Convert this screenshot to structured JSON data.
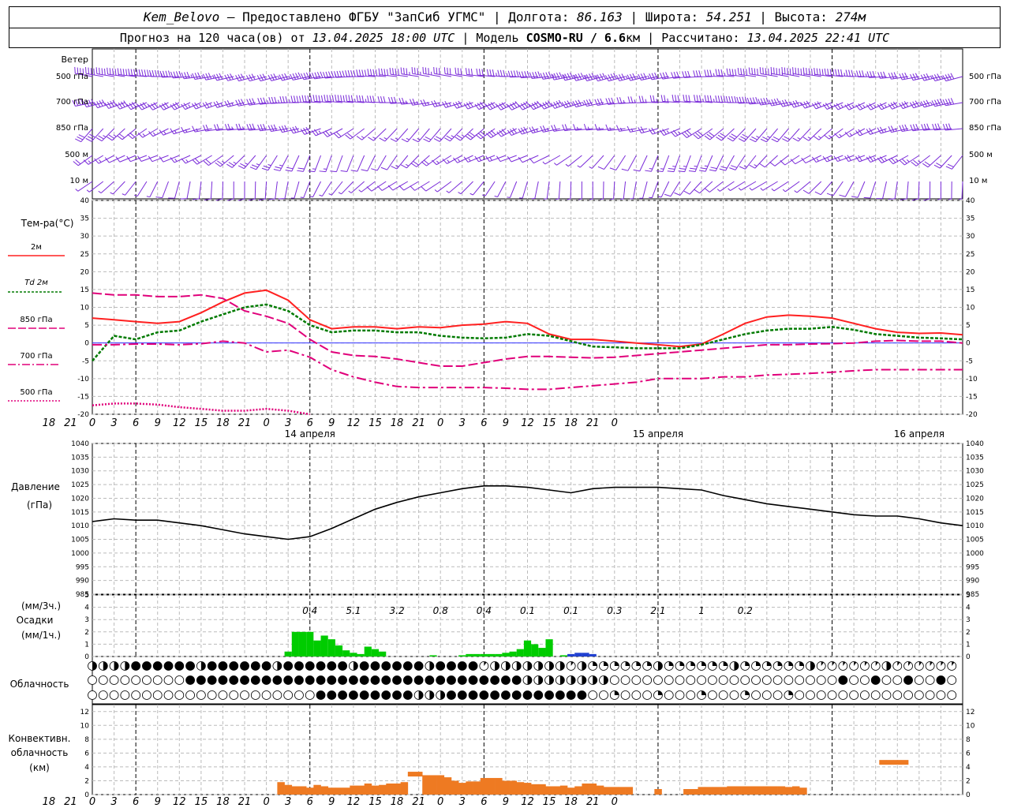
{
  "header": {
    "station": "Kem_Belovo",
    "provided": "— Предоставлено ФГБУ \"ЗапСиб УГМС\"",
    "lon_label": "Долгота:",
    "lon": "86.163",
    "lat_label": "Широта:",
    "lat": "54.251",
    "alt_label": "Высота:",
    "alt": "274м",
    "forecast_prefix": "Прогноз на 120 часа(ов) от",
    "forecast_start": "13.04.2025 18:00 UTC",
    "model_label": "Модель",
    "model": "COSMO-RU / 6.6",
    "model_unit": "км",
    "computed_label": "Рассчитано:",
    "computed": "13.04.2025 22:41 UTC"
  },
  "wind_panel": {
    "title": "Ветер",
    "levels": [
      "500 гПа",
      "700 гПа",
      "850 гПа",
      "500 м",
      "10  м"
    ]
  },
  "temp_panel": {
    "title": "Тем-ра(°C)",
    "legend": [
      {
        "label": "2м",
        "color": "#ff2020",
        "style": "solid"
      },
      {
        "label": "Td  2м",
        "color": "#007a00",
        "style": "dashed"
      },
      {
        "label": "850 гПа",
        "color": "#e0007a",
        "style": "dash"
      },
      {
        "label": "700 гПа",
        "color": "#e0007a",
        "style": "dashdot"
      },
      {
        "label": "500 гПа",
        "color": "#e0007a",
        "style": "dot"
      }
    ]
  },
  "time_axis": {
    "ticks": [
      "18",
      "21",
      "0",
      "3",
      "6",
      "9",
      "12",
      "15",
      "18",
      "21",
      "0",
      "3",
      "6",
      "9",
      "12",
      "15",
      "18",
      "21",
      "0",
      "3",
      "6",
      "9",
      "12",
      "15",
      "18",
      "21",
      "0"
    ],
    "dates": [
      "14 апреля",
      "15 апреля",
      "16 апреля"
    ]
  },
  "pressure_panel": {
    "title": "Давление",
    "unit": "(гПа)"
  },
  "precip_panel": {
    "unit_top": "(мм/3ч.)",
    "title": "Осадки",
    "unit_bottom": "(мм/1ч.)",
    "totals_3h": [
      "0.4",
      "5.1",
      "3.2",
      "0.8",
      "0.4",
      "0.1",
      "0.1",
      "0.3",
      "2.1",
      "1",
      "0.2"
    ]
  },
  "cloud_panel": {
    "title": "Облачность"
  },
  "convective_panel": {
    "title_1": "Конвективн.",
    "title_2": "облачность",
    "unit": "(км)"
  },
  "chart_data": [
    {
      "type": "line",
      "name": "temperature",
      "x_hours": [
        0,
        3,
        6,
        9,
        12,
        15,
        18,
        21,
        24,
        27,
        30,
        33,
        36,
        39,
        42,
        45,
        48,
        51,
        54,
        57,
        60,
        63,
        66,
        69,
        72,
        75,
        78,
        81,
        84,
        87,
        90,
        93,
        96,
        99,
        102,
        105,
        108,
        111,
        114,
        117,
        120
      ],
      "ylim": [
        -20,
        40
      ],
      "yticks": [
        -20,
        -15,
        -10,
        -5,
        0,
        5,
        10,
        15,
        20,
        25,
        30,
        35,
        40
      ],
      "series": [
        {
          "name": "2м",
          "color": "#ff2020",
          "values": [
            7,
            6.5,
            6,
            5.5,
            6,
            8.5,
            11.5,
            14,
            14.8,
            12,
            6.5,
            4,
            4.5,
            4.5,
            4,
            4.5,
            4.3,
            5,
            5.3,
            6,
            5.5,
            2.5,
            1,
            1,
            0.5,
            0,
            -0.5,
            -1,
            -0.3,
            2.5,
            5.5,
            7.3,
            7.8,
            7.5,
            7,
            5.5,
            4,
            3,
            2.7,
            2.8,
            2.3
          ]
        },
        {
          "name": "Td 2м",
          "color": "#007a00",
          "values": [
            -5,
            2,
            1,
            3,
            3.5,
            6,
            8,
            10,
            10.8,
            9,
            5,
            3,
            3.5,
            3.5,
            3,
            3,
            2,
            1.5,
            1.3,
            1.5,
            2.5,
            2,
            0.5,
            -1,
            -1.2,
            -1.5,
            -1.5,
            -1.5,
            -0.5,
            1,
            2.5,
            3.5,
            4,
            4,
            4.5,
            3.7,
            2.5,
            2,
            1.5,
            1.3,
            1
          ]
        },
        {
          "name": "850 гПа",
          "color": "#e0007a",
          "values": [
            14,
            13.5,
            13.5,
            13,
            13,
            13.5,
            12.5,
            9,
            7.5,
            5.5,
            1,
            -2.5,
            -3.5,
            -3.8,
            -4.5,
            -5.5,
            -6.5,
            -6.5,
            -5.5,
            -4.5,
            -3.8,
            -3.8,
            -4,
            -4.2,
            -4,
            -3.5,
            -3,
            -2.5,
            -2,
            -1.5,
            -1,
            -0.5,
            -0.5,
            -0.3,
            -0.2,
            0,
            0.5,
            0.7,
            0.5,
            0.5,
            0
          ]
        },
        {
          "name": "700 гПа",
          "color": "#e0007a",
          "values": [
            -0.5,
            -0.5,
            -0.3,
            -0.3,
            -0.5,
            -0.2,
            0.5,
            0,
            -2.5,
            -2,
            -4,
            -7.5,
            -9.5,
            -11,
            -12.2,
            -12.5,
            -12.5,
            -12.5,
            -12.5,
            -12.7,
            -13,
            -13,
            -12.5,
            -12,
            -11.5,
            -11,
            -10,
            -10,
            -10,
            -9.5,
            -9.5,
            -9,
            -8.8,
            -8.5,
            -8.2,
            -7.8,
            -7.5,
            -7.5,
            -7.5,
            -7.5,
            -7.5
          ]
        },
        {
          "name": "500 гПа",
          "color": "#e0007a",
          "values": [
            -17.5,
            -17,
            -17,
            -17.3,
            -18,
            -18.5,
            -19,
            -19,
            -18.5,
            -19,
            -20
          ]
        }
      ]
    },
    {
      "type": "line",
      "name": "pressure",
      "x_hours": [
        0,
        3,
        6,
        9,
        12,
        15,
        18,
        21,
        24,
        27,
        30,
        33,
        36,
        39,
        42,
        45,
        48,
        51,
        54,
        57,
        60,
        63,
        66,
        69,
        72,
        75,
        78,
        81,
        84,
        87,
        90,
        93,
        96,
        99,
        102,
        105,
        108,
        111,
        114,
        117,
        120
      ],
      "ylim": [
        985,
        1040
      ],
      "yticks": [
        985,
        990,
        995,
        1000,
        1005,
        1010,
        1015,
        1020,
        1025,
        1030,
        1035,
        1040
      ],
      "series": [
        {
          "name": "Давление",
          "color": "#000000",
          "values": [
            1011.5,
            1012.5,
            1012,
            1012,
            1011,
            1010,
            1008.5,
            1007,
            1006,
            1005,
            1006,
            1009,
            1012.5,
            1016,
            1018.5,
            1020.5,
            1022,
            1023.5,
            1024.5,
            1024.5,
            1024,
            1023,
            1022,
            1023.5,
            1024,
            1024,
            1024,
            1023.5,
            1023,
            1021,
            1019.5,
            1018,
            1017,
            1016,
            1015,
            1014,
            1013.5,
            1013.5,
            1012.5,
            1011,
            1010
          ]
        }
      ]
    },
    {
      "type": "bar",
      "name": "precipitation_1h",
      "x_hours": [
        27,
        28,
        29,
        30,
        31,
        32,
        33,
        34,
        35,
        36,
        37,
        38,
        39,
        40,
        41,
        42,
        43,
        44,
        45,
        46,
        47,
        48,
        49,
        50,
        51,
        52,
        53,
        54,
        55,
        56,
        57,
        58,
        59,
        60,
        61,
        62,
        63,
        64,
        65,
        66,
        67,
        68,
        69,
        70,
        71,
        72,
        73,
        74,
        75
      ],
      "ylim": [
        0,
        5
      ],
      "values": [
        0.4,
        2,
        2,
        2,
        1.3,
        1.7,
        1.4,
        0.9,
        0.5,
        0.3,
        0.2,
        0.8,
        0.6,
        0.4,
        0,
        0,
        0,
        0,
        0,
        0,
        0.1,
        0,
        0,
        0,
        0.1,
        0.2,
        0.2,
        0.2,
        0.2,
        0.2,
        0.3,
        0.4,
        0.6,
        1.3,
        1,
        0.7,
        1.4,
        0,
        0.1,
        0.2,
        0.3,
        0.3,
        0.2,
        0,
        0,
        0,
        0,
        0,
        0
      ]
    },
    {
      "type": "bar",
      "name": "convective_cloud_top_km",
      "x_hours": [
        26,
        27,
        28,
        29,
        30,
        31,
        32,
        33,
        34,
        35,
        36,
        37,
        38,
        39,
        40,
        41,
        42,
        43,
        44,
        45,
        46,
        47,
        48,
        49,
        50,
        51,
        52,
        53,
        54,
        55,
        56,
        57,
        58,
        59,
        60,
        61,
        62,
        63,
        64,
        65,
        66,
        67,
        68,
        69,
        70,
        71,
        72,
        73,
        74,
        75,
        76,
        77,
        78,
        79,
        80,
        81,
        82,
        83,
        84,
        85,
        86,
        87,
        88,
        89,
        90,
        91,
        92,
        93,
        94,
        95,
        96,
        97,
        98,
        99,
        100,
        101,
        102,
        103,
        104,
        105,
        106,
        107,
        108,
        109,
        110,
        111,
        112,
        113,
        114,
        115
      ],
      "ylim": [
        0,
        13
      ],
      "values": [
        1.8,
        1.4,
        1.2,
        1.2,
        1,
        1.4,
        1.2,
        1,
        1,
        1,
        1.3,
        1.3,
        1.6,
        1.3,
        1.4,
        1.6,
        1.6,
        1.8,
        3.3,
        3.3,
        2.8,
        2.8,
        2.8,
        2.5,
        2,
        1.7,
        1.9,
        1.9,
        2.4,
        2.4,
        2.4,
        2,
        2,
        1.8,
        1.7,
        1.5,
        1.5,
        1.2,
        1.2,
        1.3,
        1,
        1.2,
        1.6,
        1.6,
        1.3,
        1.1,
        1.1,
        1.1,
        1.1,
        0,
        0,
        0,
        0.8,
        0,
        0,
        0,
        0.8,
        0.8,
        1.1,
        1.1,
        1.1,
        1.1,
        1.2,
        1.2,
        1.2,
        1.2,
        1.2,
        1.2,
        1.2,
        1.2,
        1.1,
        1.2,
        1,
        0,
        0,
        0,
        0,
        0,
        0,
        0,
        0,
        0,
        0,
        5,
        5,
        5,
        5,
        0,
        0,
        0
      ]
    }
  ]
}
